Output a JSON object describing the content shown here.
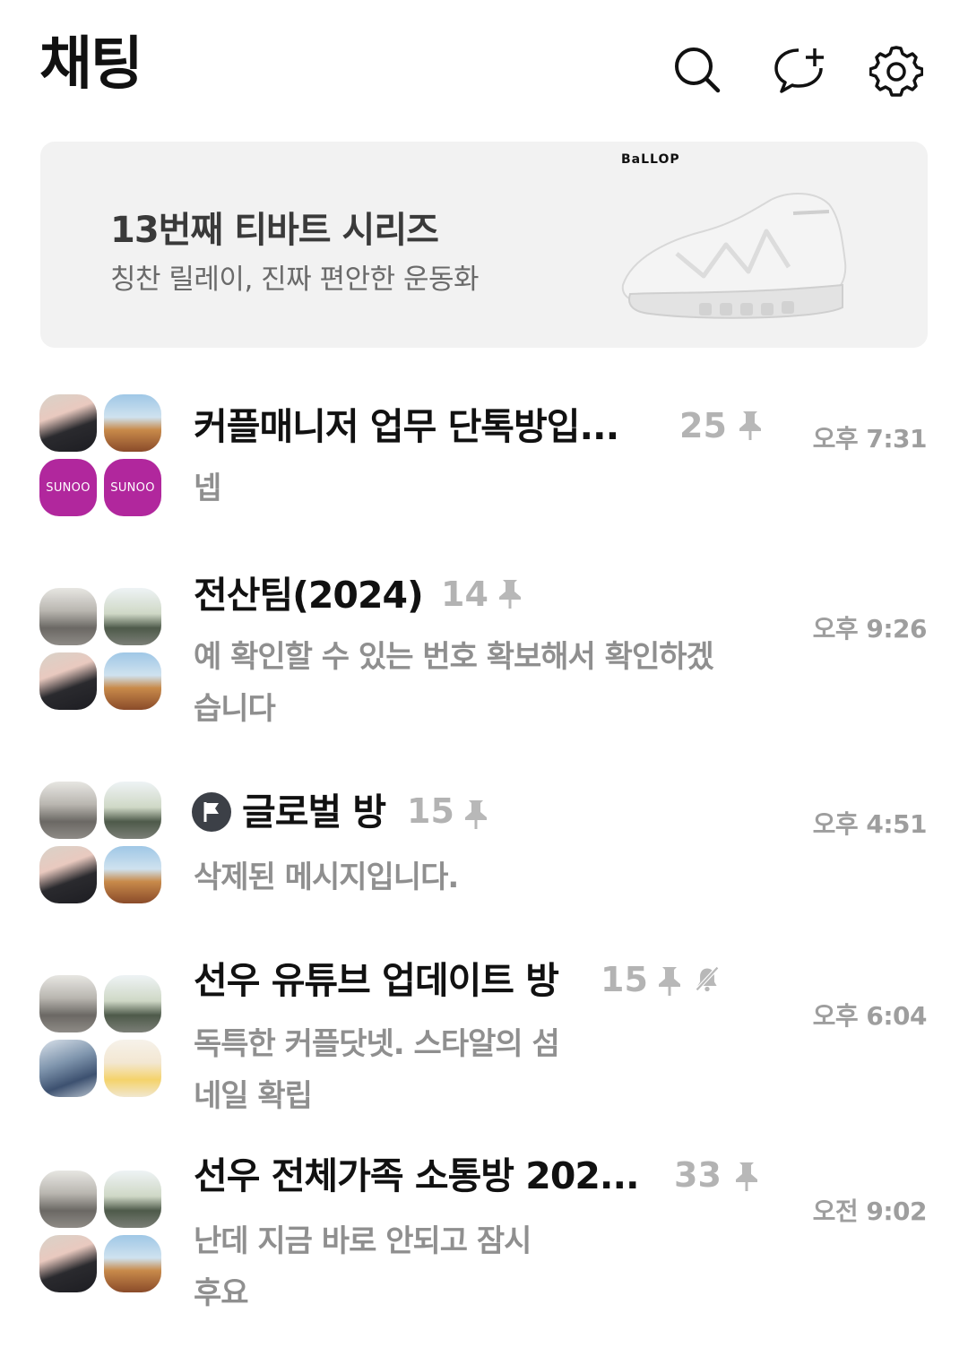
{
  "header": {
    "title": "채팅",
    "icons": [
      "search-icon",
      "new-chat-icon",
      "settings-icon"
    ]
  },
  "banner": {
    "brand": "BaLLOP",
    "title": "13번째 티바트 시리즈",
    "subtitle": "칭찬 릴레이, 진짜 편안한 운동화"
  },
  "chats": [
    {
      "name": "커플매니저 업무 단톡방입...",
      "count": "25",
      "pinned": true,
      "time": "오후 7:31",
      "message": "넵"
    },
    {
      "name": "전산팀(2024)",
      "count": "14",
      "pinned": true,
      "time": "오후 9:26",
      "message": "예 확인할 수 있는 번호 확보해서 확인하겠습니다"
    },
    {
      "name": "글로벌 방",
      "count": "15",
      "pinned": true,
      "time": "오후 4:51",
      "message": "삭제된 메시지입니다."
    },
    {
      "name": "선우 유튜브  업데이트 방",
      "count": "15",
      "pinned": true,
      "muted": true,
      "time": "오후 6:04",
      "message": "독특한 커플닷넷. 스타알의 섬네일 확립"
    },
    {
      "name": "선우 전체가족 소통방 202...",
      "count": "33",
      "pinned": true,
      "time": "오전 9:02",
      "message": "난데  지금 바로 안되고 잠시후요"
    }
  ],
  "avatar_label": "SUNOO"
}
